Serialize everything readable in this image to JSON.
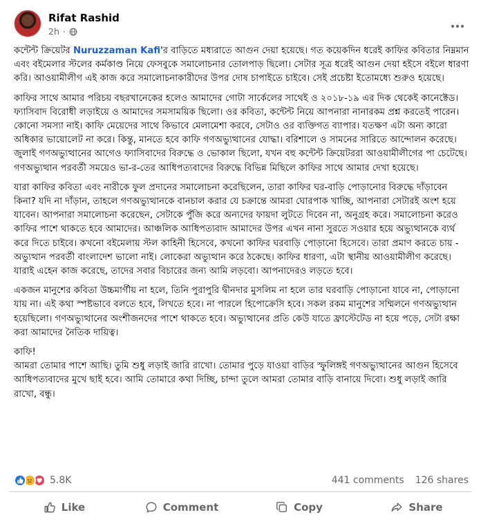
{
  "post": {
    "author": "Rifat Rashid",
    "time": "2h",
    "separator": "·",
    "privacy_icon": "globe-icon",
    "mention": "Nuruzzaman Kafi",
    "p1_prefix": "কন্টেন্ট ক্রিয়েটর ",
    "p1_suffix": "'র বাড়িতে মধ্যরাতে আগুন দেয়া হয়েছে। গত কয়েকদিন ধরেই কাফির কবিতার নিম্নমান এবং বইমেলার স্টলের কর্মকাণ্ড নিয়ে ফেসবুকে সমালোচনার তোলপাড় ছিলো। সেটার সূত্র ধরেই আগুন দেয়া হইসে বইলে ধারণা করি। আওয়ামীলীগ এই কাজ করে সমালোচনাকারীদের উপর দোষ চাপাইতে চাইবে। সেই প্রচেষ্টা ইতোমধ্যে শুরুও হয়েছে।",
    "p2": "কাফির সাথে আমার পরিচয় বছরখানেকের হলেও আমাদের গোটা সার্কেলের সাথেই ও ২০১৮-১৯ এর দিক থেকেই কানেক্টেড। ফ্যাসিবাদ বিরোধী লড়াইয়ে ও আমাদের সমসাময়িক ছিলো। ওর কবিতা, কন্টেন্ট নিয়ে আপনারা নানারকম প্রশ্ন করতেই পারেন। কোনো সমস্যা নাই। কাফি মেয়েদের সাথে কিভাবে মেলামেশা করবে, সেটাও ওর ব্যক্তিগত ব্যাপার। যতক্ষণ এটা অন্য কারো অধিকার ভায়োলেট না করে। কিন্তু, মানতে হবে কাফি গণঅভ্যুত্থানের যোদ্ধা। বরিশালে ও সামনের সারিতে আন্দোলন করেছে। জুলাই গণঅভ্যুত্থানের আগেও ফ্যাসিবাদের বিরুদ্ধে ও ভোকাল ছিলো, যখন বহু কন্টেন্ট ক্রিয়েটররা আওয়ামীলীগের পা চেটেছে। গণঅভ্যুত্থান পরবর্তী সময়েও ভা-র-তের আধিপত্যবাদের বিরুদ্ধে বিভিন্ন মিছিলে কাফির সাথে আমার দেখা হয়েছে।",
    "p3": "যারা কাফির কবিতা এবং নারীকে ফুল প্রদানের সমালোচনা করেছিলেন, তারা কাফির ঘর-বাড়ি পোড়ানোর বিরুদ্ধে দাঁড়াবেন কিনা? যদি না দাঁড়ান, তাহলে গণঅভ্যুত্থানকে বানচাল করার যে চক্রান্তে আমরা ঘোরপাক খাচ্ছি, আপনারা সেটারই অংশ হয়ে যাবেন। আপনারা সমালোচনা করেছেন, সেটাকে পুঁজি করে অন্যদের ফায়দা লুটতে দিবেন না, অনুগ্রহ করে। সমালোচনা করেও কাফির পাশে থাকতে হবে আমাদের। আঞ্চলিক আধিপত্যবাদ আমাদের উপর এখন নানা সুরতে সওয়ার হয়ে অভ্যুত্থানকে ব্যর্থ করে দিতে চাইবে। কখনো বইমেলায় স্টল কাহিনী হিসেবে, কখনো কাফির ঘরবাড়ি পোড়ানো হিসেবে। তারা প্রমাণ করতে চায় - অভ্যুত্থান পরবর্তী বাংলাদেশ ভালো নাই। লোকেরা অভ্যুত্থান করে ঠকেছে। কাফির ধারণা, এটা স্থানীয় আওয়ামীলীগ করেছে। যারাই এহেন কাজ করেছে, তাদের সবার বিচারের জন্য আমি লড়বো। আপনাদেরও লড়তে হবে।",
    "p4": "একজন মানুশের কবিতা উচ্চমার্গীয় না হলে, তিনি পুরাপুরি দ্বীনদার মুসলিম না হলে তার ঘরবাড়ি পোড়ানো যাবে না, পোড়ানো যায় না। এই কথা স্পষ্টভাবে বলতে হবে, লিখতে হবে। না পারলে হিপোক্রেসি হবে। সকল রকম মানুশের সম্মিলনে গণঅভ্যুত্থান হয়েছিলো। গণঅভ্যুত্থানের অংশীজনদের পাশে থাকতে হবে। অভ্যুত্থানের প্রতি কেউ যাতে ফ্রাস্টেটেড না হয়ে পড়ে, সেটা রক্ষা করা আমাদের নৈতিক দায়িত্ব।",
    "p5_line1": "কাফি!",
    "p5_rest": "আমরা তোমার পাশে আছি। তুমি শুধু লড়াই জারি রাখো। তোমার পুড়ে যাওয়া বাড়ির স্ফুলিঙ্গই গণঅভ্যুত্থানের আগুন হিসেবে আধিপত্যবাদের মুখে ছাই হবে। আমি তোমারে কথা দিচ্ছি, চান্দা তুলে আমরা তোমার বাড়ি বানায়ে দিবো। শুধু লড়াই জারি রাখো, বন্ধু।"
  },
  "stats": {
    "reaction_icons": [
      "like-icon",
      "sad-icon",
      "love-icon"
    ],
    "reaction_count": "5.8K",
    "comments": "441 comments",
    "shares": "126 shares"
  },
  "actions": {
    "like": "Like",
    "comment": "Comment",
    "copy": "Copy",
    "share": "Share"
  },
  "colors": {
    "mention": "#1f5fcc",
    "secondary_text": "#65676b",
    "like_blue": "#1b74e4",
    "divider": "#ced0d4"
  }
}
